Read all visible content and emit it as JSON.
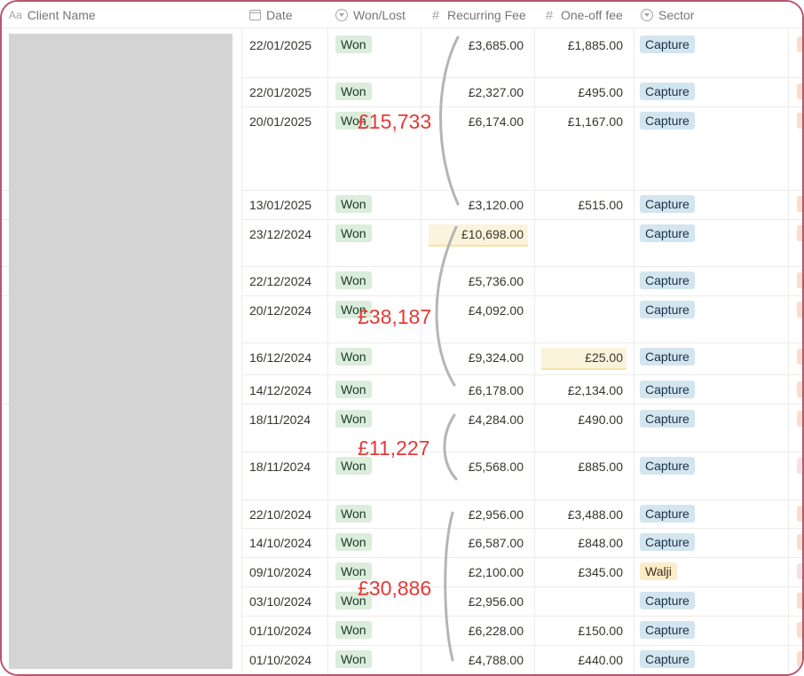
{
  "columns": {
    "client_name": {
      "icon": "Aa",
      "label": "Client Name"
    },
    "date": {
      "label": "Date"
    },
    "won_lost": {
      "label": "Won/Lost"
    },
    "recurring_fee": {
      "label": "Recurring Fee"
    },
    "one_off_fee": {
      "label": "One-off fee"
    },
    "sector": {
      "label": "Sector"
    }
  },
  "rows": [
    {
      "date": "22/01/2025",
      "status": "Won",
      "recurring": "£3,685.00",
      "oneoff": "£1,885.00",
      "sector": "Capture"
    },
    {
      "date": "22/01/2025",
      "status": "Won",
      "recurring": "£2,327.00",
      "oneoff": "£495.00",
      "sector": "Capture"
    },
    {
      "date": "20/01/2025",
      "status": "Won",
      "recurring": "£6,174.00",
      "oneoff": "£1,167.00",
      "sector": "Capture"
    },
    {
      "date": "13/01/2025",
      "status": "Won",
      "recurring": "£3,120.00",
      "oneoff": "£515.00",
      "sector": "Capture"
    },
    {
      "date": "23/12/2024",
      "status": "Won",
      "recurring": "£10,698.00",
      "oneoff": "",
      "sector": "Capture"
    },
    {
      "date": "22/12/2024",
      "status": "Won",
      "recurring": "£5,736.00",
      "oneoff": "",
      "sector": "Capture"
    },
    {
      "date": "20/12/2024",
      "status": "Won",
      "recurring": "£4,092.00",
      "oneoff": "",
      "sector": "Capture"
    },
    {
      "date": "16/12/2024",
      "status": "Won",
      "recurring": "£9,324.00",
      "oneoff": "£25.00",
      "sector": "Capture"
    },
    {
      "date": "14/12/2024",
      "status": "Won",
      "recurring": "£6,178.00",
      "oneoff": "£2,134.00",
      "sector": "Capture"
    },
    {
      "date": "18/11/2024",
      "status": "Won",
      "recurring": "£4,284.00",
      "oneoff": "£490.00",
      "sector": "Capture"
    },
    {
      "date": "18/11/2024",
      "status": "Won",
      "recurring": "£5,568.00",
      "oneoff": "£885.00",
      "sector": "Capture"
    },
    {
      "date": "22/10/2024",
      "status": "Won",
      "recurring": "£2,956.00",
      "oneoff": "£3,488.00",
      "sector": "Capture"
    },
    {
      "date": "14/10/2024",
      "status": "Won",
      "recurring": "£6,587.00",
      "oneoff": "£848.00",
      "sector": "Capture"
    },
    {
      "date": "09/10/2024",
      "status": "Won",
      "recurring": "£2,100.00",
      "oneoff": "£345.00",
      "sector": "Walji"
    },
    {
      "date": "03/10/2024",
      "status": "Won",
      "recurring": "£2,956.00",
      "oneoff": "",
      "sector": "Capture"
    },
    {
      "date": "01/10/2024",
      "status": "Won",
      "recurring": "£6,228.00",
      "oneoff": "£150.00",
      "sector": "Capture"
    },
    {
      "date": "01/10/2024",
      "status": "Won",
      "recurring": "£4,788.00",
      "oneoff": "£440.00",
      "sector": "Capture"
    }
  ],
  "annotations": {
    "january": "£15,733",
    "december": "£38,187",
    "november": "£11,227",
    "october": "£30,886"
  },
  "colors": {
    "frame": "#b9566f",
    "annotation": "#e53935",
    "won_tag": "#dbeddb",
    "capture_tag": "#d3e5ef",
    "walji_tag": "#fdecc8"
  }
}
